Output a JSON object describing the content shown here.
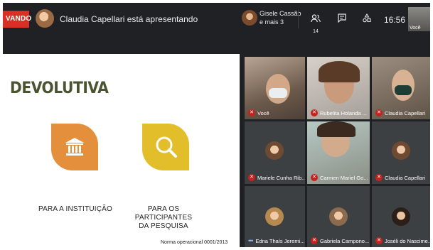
{
  "topbar": {
    "recording_badge": "VANDO",
    "presenter_text": "Claudia Capellari está apresentando",
    "others_line1": "Gisele Cassão",
    "others_line2": "e mais 3",
    "participants_count": "14",
    "clock": "16:56",
    "self_label": "Você",
    "icons": [
      "people-icon",
      "chat-icon",
      "activities-icon"
    ]
  },
  "slide": {
    "title": "DEVOLUTIVA",
    "caption_left": "PARA A INSTITUIÇÃO",
    "caption_right_line1": "PARA OS PARTICIPANTES",
    "caption_right_line2": "DA PESQUISA",
    "footer": "Norma operacional 0001/2013",
    "colors": {
      "title": "#4a5431",
      "orange": "#e38f3c",
      "yellow": "#e1be2a"
    }
  },
  "participants": [
    {
      "name": "Você",
      "muted": true
    },
    {
      "name": "Rubelita Holanda ...",
      "muted": true
    },
    {
      "name": "Claudia Capellari",
      "muted": true
    },
    {
      "name": "Mariele Cunha Rib...",
      "muted": true
    },
    {
      "name": "Carmen Mariel Go...",
      "muted": true
    },
    {
      "name": "Claudia Capellari",
      "muted": true
    },
    {
      "name": "Edna Thaís Jeremi...",
      "muted": false
    },
    {
      "name": "Gabriela Campono...",
      "muted": true
    },
    {
      "name": "Joséli do Nascime...",
      "muted": true
    }
  ]
}
